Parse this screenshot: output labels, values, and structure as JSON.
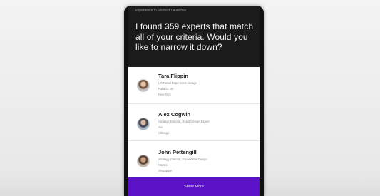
{
  "header": {
    "caption": "experience in Product Launches"
  },
  "chat": {
    "message_prefix": "I found ",
    "count": "359",
    "message_suffix": " experts that match all of your criteria. Would you like to narrow it down?"
  },
  "experts": [
    {
      "name": "Tara Flippin",
      "title": "UX Retail Experience Design",
      "company": "Publicis NA",
      "location": "New York"
    },
    {
      "name": "Alex Cogwin",
      "title": "Creative Director, Retail Design Expert",
      "company": "Arc",
      "location": "Chicago"
    },
    {
      "name": "John Pettengill",
      "title": "Strategy Director, Experience Design",
      "company": "Narrus",
      "location": "Singapore"
    }
  ],
  "actions": {
    "show_more_label": "Show More"
  }
}
